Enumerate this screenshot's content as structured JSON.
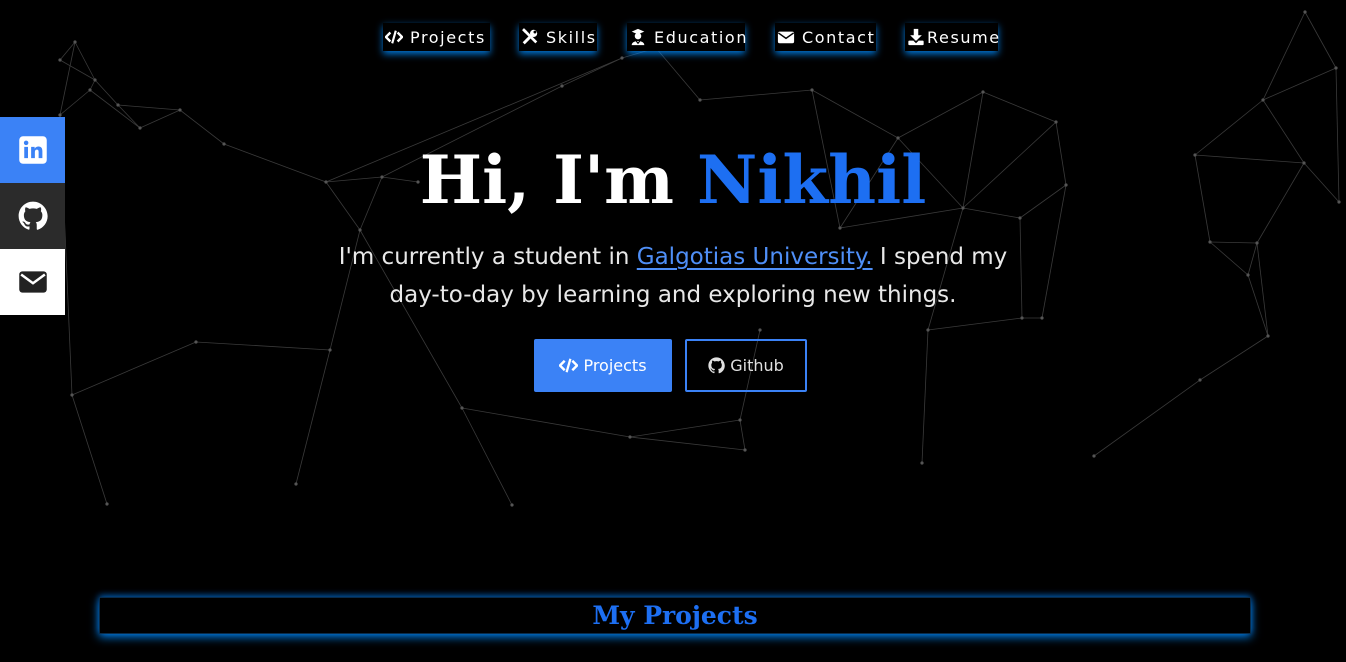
{
  "nav": {
    "items": [
      {
        "label": "Projects",
        "icon": "code-icon"
      },
      {
        "label": "Skills",
        "icon": "tools-icon"
      },
      {
        "label": "Education",
        "icon": "graduate-icon"
      },
      {
        "label": "Contact",
        "icon": "envelope-icon"
      },
      {
        "label": "Resume",
        "icon": "download-icon"
      }
    ]
  },
  "social": [
    {
      "icon": "linkedin-icon",
      "color": "#3b82f6"
    },
    {
      "icon": "github-icon",
      "color": "#2b2b2b"
    },
    {
      "icon": "mail-icon",
      "color": "#ffffff"
    }
  ],
  "hero": {
    "greeting": "Hi, I'm ",
    "name": "Nikhil",
    "text_before": "I'm currently a student in ",
    "university": "Galgotias University.",
    "text_after": " I spend my day-to-day by learning and exploring new things."
  },
  "buttons": {
    "projects": "Projects",
    "github": "Github"
  },
  "section": {
    "title": "My Projects"
  },
  "colors": {
    "accent": "#3b82f6",
    "name": "#1d6ff2",
    "glow": "#008cff",
    "background": "#000000"
  }
}
